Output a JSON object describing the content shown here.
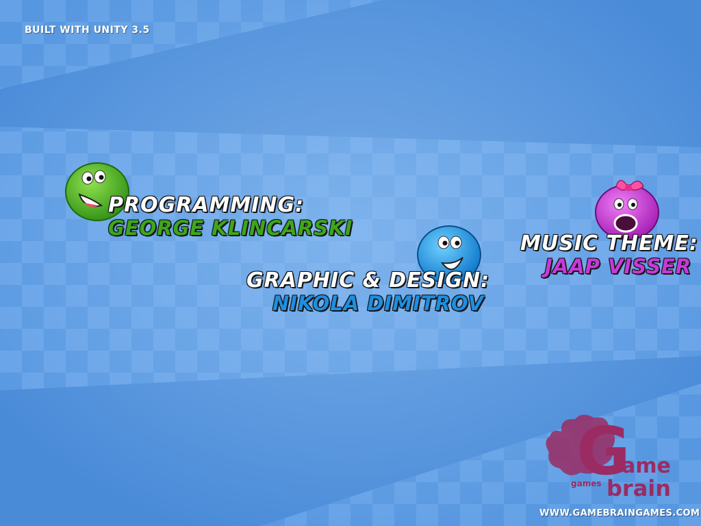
{
  "header": {
    "built_with": "BUILT WITH UNITY 3.5"
  },
  "credits": [
    {
      "role": "PROGRAMMING:",
      "name": "GEORGE KLINCARSKI",
      "color": "#3fa61c",
      "character": "green-smiley-icon"
    },
    {
      "role": "GRAPHIC & DESIGN:",
      "name": "NIKOLA DIMITROV",
      "color": "#1e8fe0",
      "character": "blue-smiley-icon"
    },
    {
      "role": "MUSIC THEME:",
      "name": "JAAP VISSER",
      "color": "#c83ad8",
      "character": "pink-smiley-icon"
    }
  ],
  "logo": {
    "letter": "G",
    "word1": "ame",
    "word2": "brain",
    "small": "games",
    "color": "#9b2b63"
  },
  "footer": {
    "url": "WWW.GAMEBRAINGAMES.COM"
  },
  "colors": {
    "background": "#4f90db",
    "stripe": "#6aa6e8"
  }
}
